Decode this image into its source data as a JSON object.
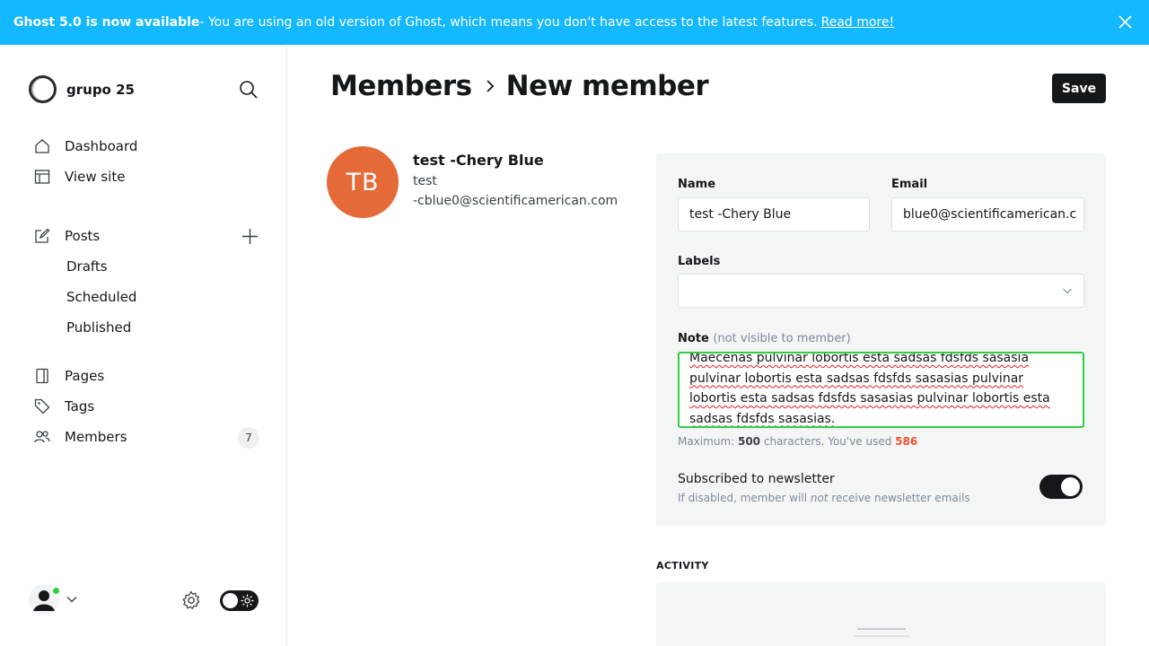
{
  "banner": {
    "bold": "Ghost 5.0 is now available",
    "text": " - You are using an old version of Ghost, which means you don't have access to the latest features.",
    "link": "Read more!"
  },
  "sidebar": {
    "site_name": "grupo 25",
    "nav": {
      "dashboard": "Dashboard",
      "view_site": "View site",
      "posts": "Posts",
      "drafts": "Drafts",
      "scheduled": "Scheduled",
      "published": "Published",
      "pages": "Pages",
      "tags": "Tags",
      "members": "Members",
      "members_count": "7"
    }
  },
  "header": {
    "crumb_parent": "Members",
    "crumb_current": "New member",
    "save_label": "Save"
  },
  "member": {
    "initials": "TB",
    "name": "test -Chery Blue",
    "line1": "test",
    "line2": "-cblue0@scientificamerican.com"
  },
  "form": {
    "name_label": "Name",
    "name_value": "test -Chery Blue",
    "email_label": "Email",
    "email_value": "blue0@scientificamerican.c",
    "labels_label": "Labels",
    "labels_value": "",
    "note_label": "Note",
    "note_hint": "(not visible to member)",
    "note_value": "Maecenas pulvinar lobortis esta sadsas fdsfds sasasia pulvinar lobortis esta sadsas fdsfds sasasias pulvinar lobortis esta sadsas fdsfds sasasias pulvinar lobortis esta sadsas fdsfds sasasias.",
    "counter_prefix": "Maximum: ",
    "counter_max": "500",
    "counter_mid": " characters. You've used ",
    "counter_used": "586",
    "newsletter_title": "Subscribed to newsletter",
    "newsletter_sub_a": "If disabled, member will ",
    "newsletter_sub_em": "not",
    "newsletter_sub_b": " receive newsletter emails",
    "newsletter_on": true
  },
  "activity": {
    "heading": "ACTIVITY"
  },
  "colors": {
    "banner": "#14b8ff",
    "avatar": "#e46a38",
    "note_border": "#30cf43",
    "over_limit": "#f05230"
  }
}
